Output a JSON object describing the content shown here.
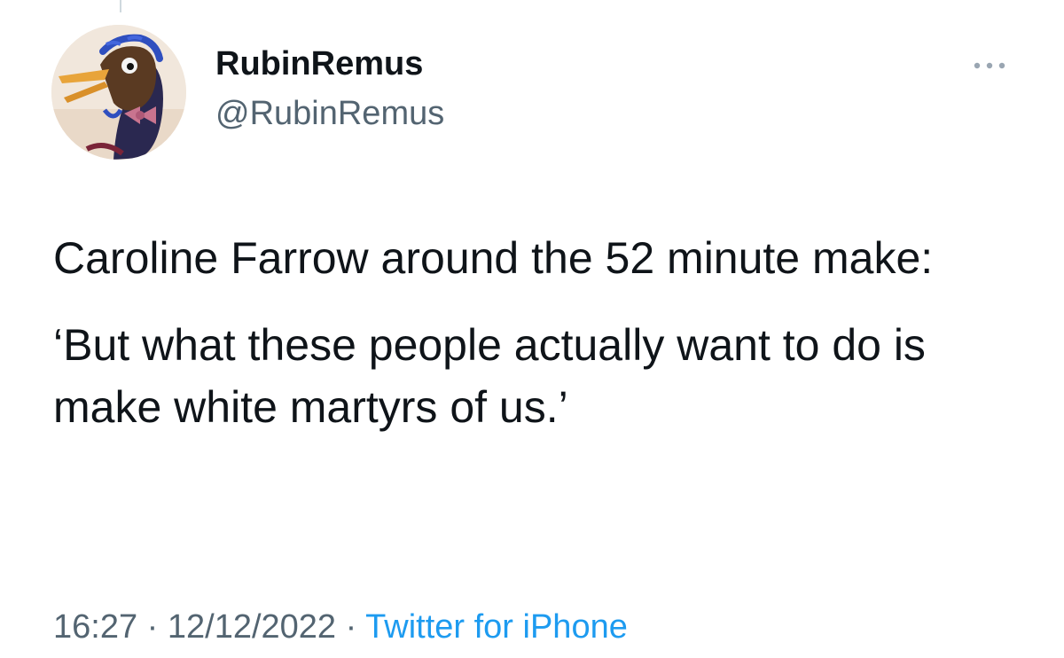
{
  "tweet": {
    "display_name": "RubinRemus",
    "handle": "@RubinRemus",
    "paragraphs": [
      "Caroline Farrow around the 52 minute make:",
      "‘But what these people actually want to do is make white martyrs of us.’"
    ],
    "time": "16:27",
    "separator": "·",
    "date": "12/12/2022",
    "source": "Twitter for iPhone"
  },
  "icons": {
    "more": "more-horizontal-icon",
    "avatar": "puppet-bird-avatar"
  },
  "colors": {
    "text_primary": "#0f1419",
    "text_secondary": "#536471",
    "link": "#1d9bf0",
    "background": "#ffffff"
  }
}
